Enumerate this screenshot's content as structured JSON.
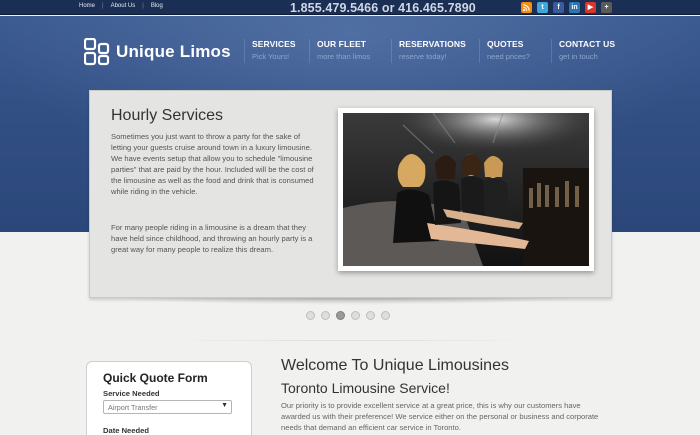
{
  "topbar": {
    "links": [
      "Home",
      "About Us",
      "Blog"
    ],
    "phone": "1.855.479.5466 or 416.465.7890",
    "social": [
      {
        "name": "rss-icon",
        "color": "#f28d16"
      },
      {
        "name": "twitter-icon",
        "color": "#3da7d9"
      },
      {
        "name": "facebook-icon",
        "color": "#3b5aa0"
      },
      {
        "name": "linkedin-icon",
        "color": "#2a75b2"
      },
      {
        "name": "youtube-icon",
        "color": "#d8362a"
      },
      {
        "name": "googleplus-icon",
        "color": "#5b5b5b"
      }
    ]
  },
  "logo": {
    "text": "Unique Limos"
  },
  "nav": [
    {
      "title": "SERVICES",
      "sub": "Pick Yours!"
    },
    {
      "title": "OUR FLEET",
      "sub": "more than limos"
    },
    {
      "title": "RESERVATIONS",
      "sub": "reserve today!"
    },
    {
      "title": "QUOTES",
      "sub": "need prices?"
    },
    {
      "title": "CONTACT US",
      "sub": "get in touch"
    }
  ],
  "slide": {
    "title": "Hourly Services",
    "p1": "Sometimes you just want to throw a party for the sake of letting your guests cruise around town in a luxury limousine. We have events setup that allow you to schedule \"limousine parties\" that are paid by the hour. Included will be the cost of the limousine as well as the food and drink that is consumed while riding in the vehicle.",
    "p2": "For many people riding in a limousine is a dream that they have held since childhood, and throwing an hourly party is a great way for many people to realize this dream."
  },
  "slider": {
    "count": 6,
    "active": 3
  },
  "quote_form": {
    "title": "Quick Quote Form",
    "service_label": "Service Needed",
    "service_value": "Airport Transfer",
    "date_label": "Date Needed"
  },
  "welcome": {
    "title": "Welcome To Unique Limousines",
    "subtitle": "Toronto Limousine Service!",
    "body": "Our priority is to provide excellent service at a great price, this is why our customers have awarded us with their preference! We service either on the personal or business and corporate needs that demand an efficient car service in Toronto."
  }
}
